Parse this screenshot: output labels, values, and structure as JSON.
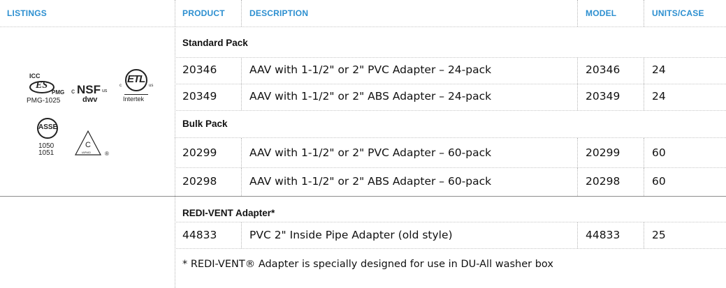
{
  "header": {
    "listings": "LISTINGS",
    "product": "PRODUCT",
    "description": "DESCRIPTION",
    "model": "MODEL",
    "units_case": "UNITS/CASE"
  },
  "colors": {
    "accent": "#2c8fd0",
    "text": "#111111",
    "rule": "#c6c6c6"
  },
  "listings": {
    "icc": {
      "top": "ICC",
      "mark": "ES",
      "pmg": "PMG",
      "code": "PMG-1025"
    },
    "nsf": {
      "c": "c",
      "mark": "NSF",
      "us": "us",
      "sub": "dwv"
    },
    "etl": {
      "mark": "ETL",
      "c": "c",
      "us": "us",
      "name": "Intertek"
    },
    "asse": {
      "mark": "ASSE",
      "num1": "1050",
      "num2": "1051"
    },
    "iapmo": {
      "mark": "C",
      "sub": "IAPMO",
      "reg": "®"
    }
  },
  "sections": [
    {
      "title": "Standard Pack",
      "rows": [
        {
          "product": "20346",
          "description": "AAV with 1-1/2\" or 2\" PVC Adapter – 24-pack",
          "model": "20346",
          "units": "24"
        },
        {
          "product": "20349",
          "description": "AAV with 1-1/2\" or 2\" ABS Adapter – 24-pack",
          "model": "20349",
          "units": "24"
        }
      ]
    },
    {
      "title": "Bulk Pack",
      "rows": [
        {
          "product": "20299",
          "description": "AAV with 1-1/2\" or 2\" PVC Adapter – 60-pack",
          "model": "20299",
          "units": "60"
        },
        {
          "product": "20298",
          "description": "AAV with 1-1/2\" or 2\" ABS Adapter – 60-pack",
          "model": "20298",
          "units": "60"
        }
      ]
    },
    {
      "title": "REDI-VENT Adapter*",
      "rows": [
        {
          "product": "44833",
          "description": "PVC 2\" Inside Pipe Adapter (old style)",
          "model": "44833",
          "units": "25"
        }
      ]
    }
  ],
  "footnote": "* REDI-VENT® Adapter is specially designed for use in DU-All washer box"
}
